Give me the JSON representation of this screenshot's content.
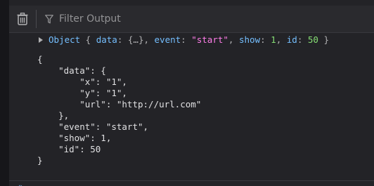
{
  "toolbar": {
    "filter_placeholder": "Filter Output"
  },
  "message": {
    "summary": {
      "object_label": "Object",
      "open_brace": " { ",
      "key_data": "data",
      "data_value": ": {…}, ",
      "key_event": "event",
      "event_sep": ": ",
      "event_value": "\"start\"",
      "after_event": ", ",
      "key_show": "show",
      "show_sep": ": ",
      "show_value": "1",
      "after_show": ", ",
      "key_id": "id",
      "id_sep": ": ",
      "id_value": "50",
      "close_brace": " }"
    },
    "json_lines": [
      "{",
      "    \"data\": {",
      "        \"x\": \"1\",",
      "        \"y\": \"1\",",
      "        \"url\": \"http://url.com\"",
      "    },",
      "    \"event\": \"start\",",
      "    \"show\": 1,",
      "    \"id\": 50",
      "}"
    ]
  },
  "colors": {
    "background": "#232327",
    "toolbar": "#2a2a2e",
    "object_label": "#75bfff",
    "string_value": "#ff7de9",
    "number_value": "#86de74"
  }
}
